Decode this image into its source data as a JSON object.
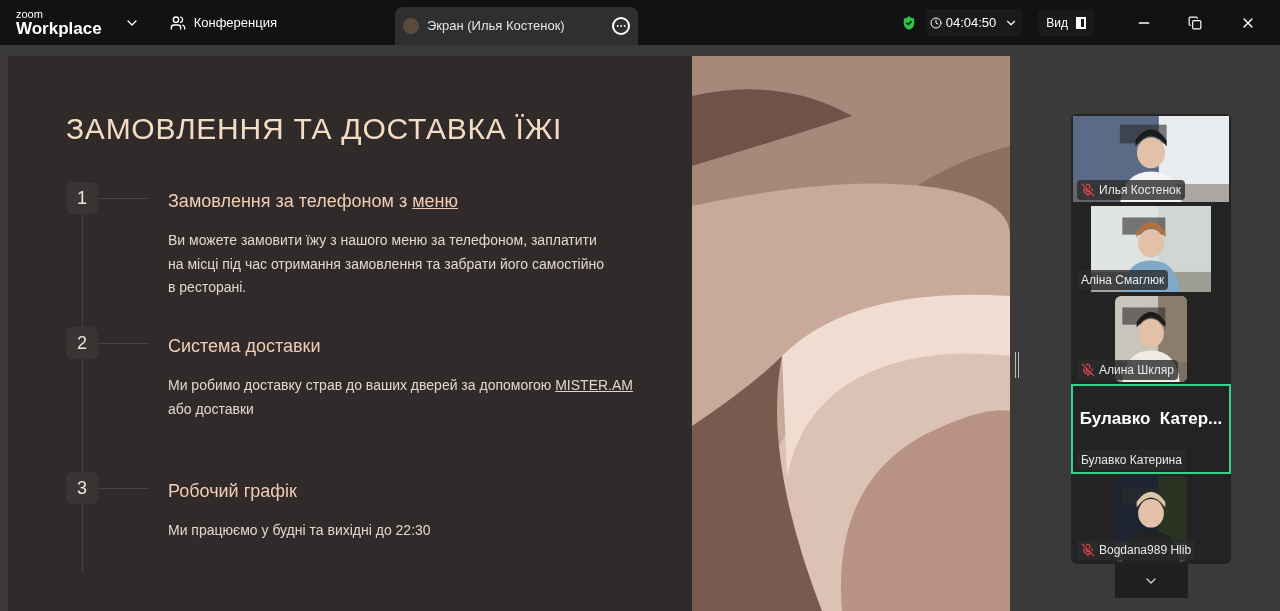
{
  "app": {
    "logo_top": "zoom",
    "logo_bottom": "Workplace",
    "meeting_label": "Конференция"
  },
  "share_tab": {
    "title": "Экран (Илья Костенок)",
    "selected": true
  },
  "status": {
    "secure": true,
    "timer": "04:04:50",
    "view_label": "Вид"
  },
  "slide": {
    "title": "ЗАМОВЛЕННЯ ТА ДОСТАВКА ЇЖІ",
    "items": [
      {
        "number": "1",
        "title": {
          "text": "Замовлення за телефоном з ",
          "link": "меню"
        },
        "body": [
          {
            "text": "Ви можете замовити їжу з нашого меню за телефоном, заплатити"
          },
          {
            "text": "на місці під час отримання замовлення та забрати його самостійно"
          },
          {
            "text": "в ресторані."
          }
        ]
      },
      {
        "number": "2",
        "title": {
          "text": "Система доставки"
        },
        "body": [
          {
            "text": "Ми робимо доставку страв до ваших дверей за допомогою ",
            "link": "MISTER.AM"
          },
          {
            "text": "або доставки"
          }
        ]
      },
      {
        "number": "3",
        "title": {
          "text": "Робочий графік"
        },
        "body": [
          {
            "text": "Ми працюємо у будні та вихідні до 22:30"
          }
        ]
      }
    ]
  },
  "participants": [
    {
      "name": "Илья Костенок",
      "kind": "widescreen",
      "muted": true,
      "selected": false
    },
    {
      "name": "Аліна Смаглюк",
      "kind": "standard",
      "muted": false,
      "selected": false
    },
    {
      "name": "Алина Шкляр",
      "kind": "portrait",
      "muted": true,
      "selected": false
    },
    {
      "name": "Булавко Катерина",
      "kind": "avatar",
      "display": "Булавко  Катер...",
      "muted": false,
      "selected": true
    },
    {
      "name": "Bogdana989 Hlib",
      "kind": "portrait",
      "muted": true,
      "selected": false
    }
  ]
}
